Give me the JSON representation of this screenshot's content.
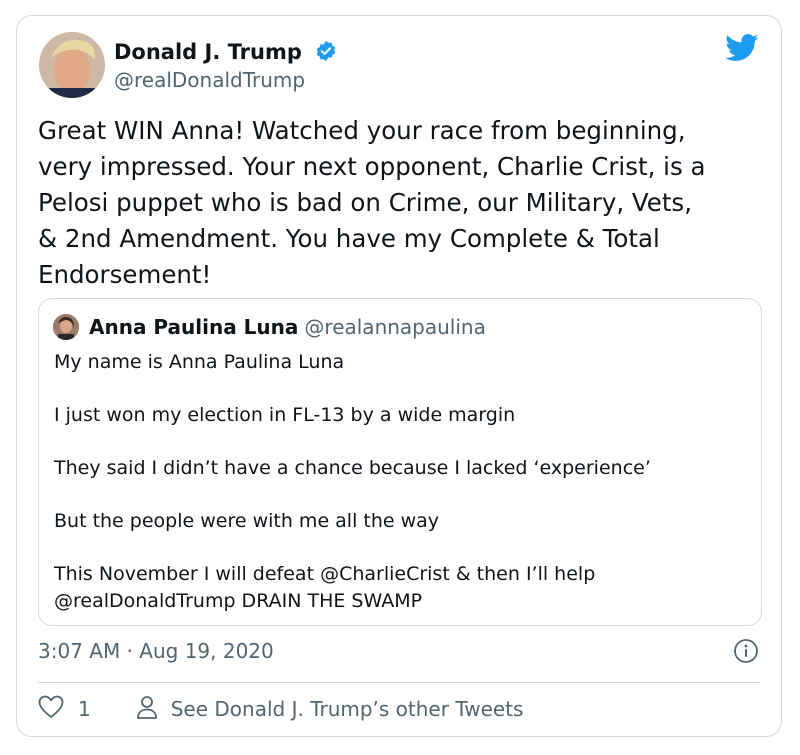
{
  "author": {
    "name": "Donald J. Trump",
    "handle": "@realDonaldTrump",
    "verified": true,
    "avatar_icon": "avatar"
  },
  "tweet": {
    "text": "Great WIN Anna! Watched your race from beginning,\nvery impressed. Your next opponent, Charlie Crist, is a\nPelosi puppet who is bad on Crime, our Military, Vets,\n& 2nd Amendment. You have my Complete & Total\nEndorsement!"
  },
  "quoted": {
    "name": "Anna Paulina Luna",
    "handle": "@realannapaulina",
    "lines": [
      "My name is Anna Paulina Luna",
      "",
      "I just won my election in FL-13 by a wide margin",
      "",
      "They said I didn’t have a chance because I lacked ‘experience’",
      "",
      "But the people were with me all the way",
      "",
      "This November I will defeat @CharlieCrist & then I’ll help",
      "@realDonaldTrump DRAIN THE SWAMP"
    ]
  },
  "meta": {
    "timestamp": "3:07 AM · Aug 19, 2020"
  },
  "actions": {
    "like_count": "1",
    "other_tweets_label": "See Donald J. Trump’s other Tweets"
  },
  "colors": {
    "twitter_blue": "#1d9bf0",
    "text_primary": "#0f1419",
    "text_secondary": "#536471",
    "border": "#cfd9de"
  }
}
